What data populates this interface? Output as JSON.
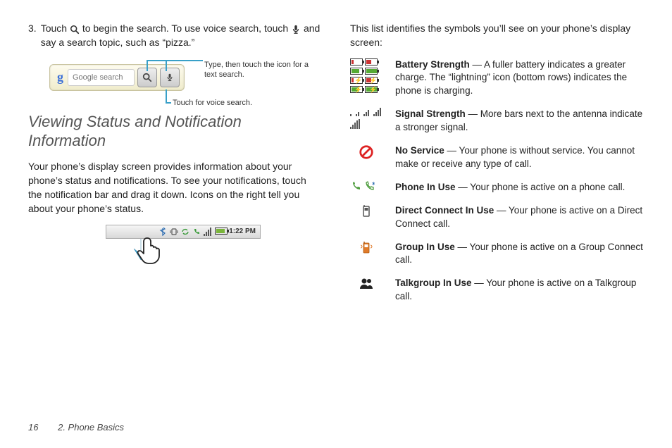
{
  "left": {
    "step_num": "3.",
    "step_text_1": "Touch ",
    "step_text_2": " to begin the search. To use voice search, touch ",
    "step_text_3": " and say a search topic, such as “pizza.”",
    "search_placeholder": "Google search",
    "callout_search": "Type, then touch the icon for a text search.",
    "callout_voice": "Touch for voice search.",
    "heading": "Viewing Status and Notification Information",
    "para": "Your phone’s display screen provides information about your phone’s status and notifications. To see your notifications, touch the notification bar and drag it down. Icons on the right tell you about your phone’s status.",
    "status_time": "1:22 PM"
  },
  "right": {
    "intro": "This list identifies the symbols you’ll see on your phone’s display screen:",
    "rows": [
      {
        "title": "Battery Strength",
        "desc": " — A fuller battery indicates a greater charge. The “lightning” icon (bottom rows) indicates the phone is charging."
      },
      {
        "title": "Signal Strength",
        "desc": " — More bars next to the antenna indicate a stronger signal."
      },
      {
        "title": "No Service",
        "desc": " — Your phone is without service. You cannot make or receive any type of call."
      },
      {
        "title": "Phone In Use",
        "desc": " — Your phone is active on a phone call."
      },
      {
        "title": "Direct Connect In Use",
        "desc": " — Your phone is active on a Direct Connect call."
      },
      {
        "title": "Group In Use",
        "desc": " — Your phone is active on a Group Connect call."
      },
      {
        "title": "Talkgroup In Use",
        "desc": " — Your phone is active on a Talkgroup call."
      }
    ]
  },
  "footer": {
    "page": "16",
    "chapter": "2. Phone Basics"
  }
}
